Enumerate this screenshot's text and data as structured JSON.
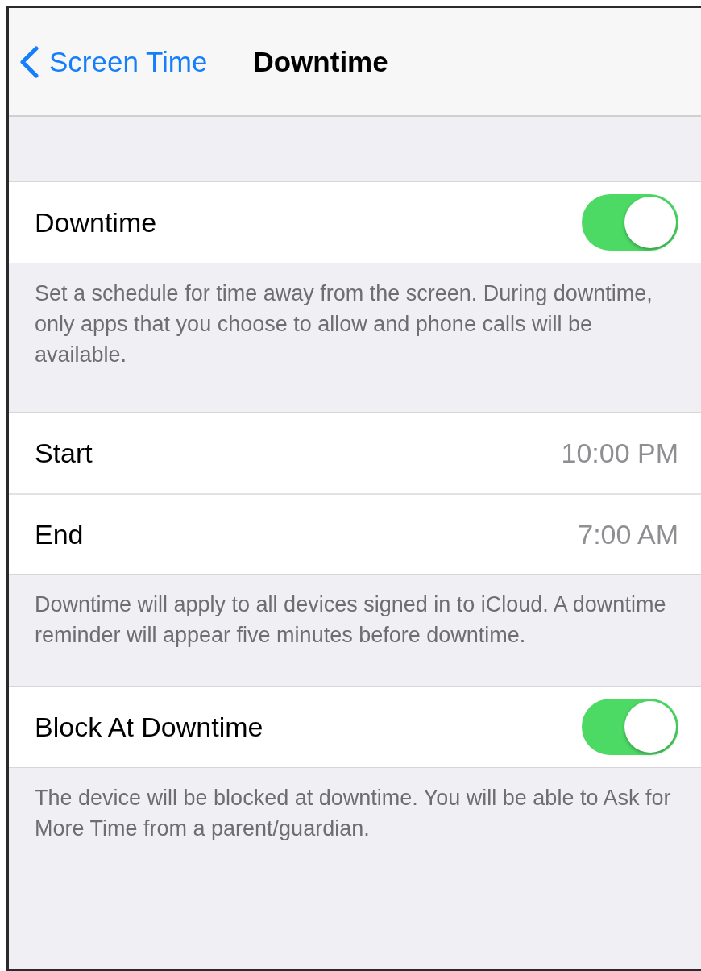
{
  "nav": {
    "back": "Screen Time",
    "title": "Downtime"
  },
  "sections": [
    {
      "rows": [
        {
          "kind": "toggle",
          "label": "Downtime",
          "on": true
        }
      ],
      "footer": "Set a schedule for time away from the screen. During downtime, only apps that you choose to allow and phone calls will be available."
    },
    {
      "rows": [
        {
          "kind": "value",
          "label": "Start",
          "value": "10:00 PM"
        },
        {
          "kind": "value",
          "label": "End",
          "value": "7:00 AM"
        }
      ],
      "footer": "Downtime will apply to all devices signed in to iCloud. A downtime reminder will appear five minutes before downtime."
    },
    {
      "rows": [
        {
          "kind": "toggle",
          "label": "Block At Downtime",
          "on": true
        }
      ],
      "footer": "The device will be blocked at downtime. You will be able to Ask for More Time from a parent/guardian."
    }
  ]
}
